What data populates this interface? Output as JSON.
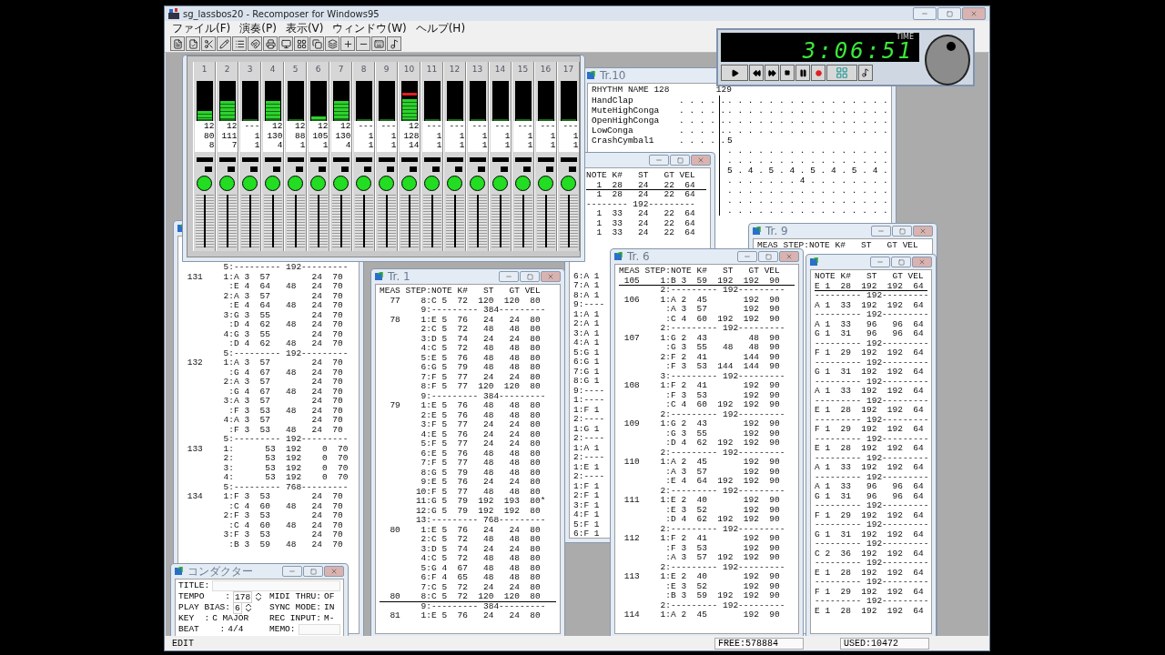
{
  "app": {
    "title": "sg_lassbos20 - Recomposer for Windows95",
    "menu": [
      "ファイル(F)",
      "演奏(P)",
      "表示(V)",
      "ウィンドウ(W)",
      "ヘルプ(H)"
    ]
  },
  "transport": {
    "time": "3:06:51",
    "time_label": "TIME"
  },
  "mixer": {
    "channels": [
      {
        "number": "1",
        "level": 0.25,
        "peak": false,
        "readings": [
          "12",
          "80",
          "8"
        ]
      },
      {
        "number": "2",
        "level": 0.5,
        "peak": false,
        "readings": [
          "12",
          "111",
          "7"
        ]
      },
      {
        "number": "3",
        "level": 0,
        "peak": false,
        "readings": [
          "---",
          "1",
          "1"
        ]
      },
      {
        "number": "4",
        "level": 0.5,
        "peak": false,
        "readings": [
          "12",
          "130",
          "4"
        ]
      },
      {
        "number": "5",
        "level": 0,
        "peak": false,
        "readings": [
          "12",
          "88",
          "1"
        ]
      },
      {
        "number": "6",
        "level": 0.12,
        "peak": false,
        "readings": [
          "12",
          "105",
          "1"
        ]
      },
      {
        "number": "7",
        "level": 0.5,
        "peak": false,
        "readings": [
          "12",
          "130",
          "4"
        ]
      },
      {
        "number": "8",
        "level": 0,
        "peak": false,
        "readings": [
          "---",
          "1",
          "1"
        ]
      },
      {
        "number": "9",
        "level": 0,
        "peak": false,
        "readings": [
          "---",
          "1",
          "1"
        ]
      },
      {
        "number": "10",
        "level": 0.55,
        "peak": true,
        "readings": [
          "12",
          "128",
          "14"
        ]
      },
      {
        "number": "11",
        "level": 0,
        "peak": false,
        "readings": [
          "---",
          "1",
          "1"
        ]
      },
      {
        "number": "12",
        "level": 0,
        "peak": false,
        "readings": [
          "---",
          "1",
          "1"
        ]
      },
      {
        "number": "13",
        "level": 0,
        "peak": false,
        "readings": [
          "---",
          "1",
          "1"
        ]
      },
      {
        "number": "14",
        "level": 0,
        "peak": false,
        "readings": [
          "---",
          "1",
          "1"
        ]
      },
      {
        "number": "15",
        "level": 0,
        "peak": false,
        "readings": [
          "---",
          "1",
          "1"
        ]
      },
      {
        "number": "16",
        "level": 0,
        "peak": false,
        "readings": [
          "---",
          "1",
          "1"
        ]
      },
      {
        "number": "17",
        "level": 0,
        "peak": false,
        "readings": [
          "---",
          "1",
          "1"
        ]
      }
    ]
  },
  "rhythm_window": {
    "title": "Tr.10",
    "header": "RHYTHM NAME 128         129",
    "rows": [
      {
        "name": "HandClap",
        "bar_128": ". . . . .",
        "bar_129": ". . . . . . . . . . . . . . . ."
      },
      {
        "name": "MuteHighConga",
        "bar_128": ". . . . .",
        "bar_129": ". . . . . . . . . . . . . . . ."
      },
      {
        "name": "OpenHighConga",
        "bar_128": ". . . . .",
        "bar_129": ". . . . . . . . . . . . . . . ."
      },
      {
        "name": "LowConga",
        "bar_128": ". . . . .",
        "bar_129": ". . . . . . . . . . . . . . . ."
      },
      {
        "name": "CrashCymbal1",
        "bar_128": ". . . . .",
        "bar_129": "5"
      },
      {
        "bar_129": ". . . . . . . . . . . . . . . ."
      },
      {
        "bar_129": ". . . . . . . . . . . . . . . ."
      },
      {
        "bar_129": "5 . 4 . 5 . 4 . 5 . 4 . 5 . 4 ."
      },
      {
        "bar_129": ". . . . . . . 4 . . . . . . . ."
      },
      {
        "bar_129": ". . . . . . . . . . . . . . . ."
      },
      {
        "bar_129": ". . . . . . . . . . . . . . . ."
      },
      {
        "bar_129": ". . . . . . . . . . . . . . . ."
      }
    ]
  },
  "left_list": {
    "rows": [
      "        5:--------- 192---------",
      " 131    1:A 3  57        24  70",
      "         :E 4  64   48   24  70",
      "        2:A 3  57        24  70",
      "         :E 4  64   48   24  70",
      "        3:G 3  55        24  70",
      "         :D 4  62   48   24  70",
      "        4:G 3  55        24  70",
      "         :D 4  62   48   24  70",
      "        5:--------- 192---------",
      " 132    1:A 3  57        24  70",
      "         :G 4  67   48   24  70",
      "        2:A 3  57        24  70",
      "         :G 4  67   48   24  70",
      "        3:A 3  57        24  70",
      "         :F 3  53   48   24  70",
      "        4:A 3  57        24  70",
      "         :F 3  53   48   24  70",
      "        5:--------- 192---------",
      " 133    1:      53  192    0  70",
      "        2:      53  192    0  70",
      "        3:      53  192    0  70",
      "        4:      53  192    0  70",
      "        5:--------- 768---------",
      " 134    1:F 3  53        24  70",
      "         :C 4  60   48   24  70",
      "        2:F 3  53        24  70",
      "         :C 4  60   48   24  70",
      "        3:F 3  53        24  70",
      "         :B 3  59   48   24  70"
    ]
  },
  "note_window": {
    "header": "NOTE K#   ST   GT VEL",
    "rows": [
      {
        "text": "  1  28   24   22  64",
        "current": true
      },
      "  1  28   24   22  64",
      "-------- 192---------",
      "  1  33   24   22  64",
      "  1  33   24   22  64",
      "  1  33   24   22  64"
    ],
    "strip_rows": [
      "6:A 1",
      "7:A 1",
      "8:A 1",
      "9:----",
      "1:A 1",
      "2:A 1",
      "3:A 1",
      "4:A 1",
      "5:G 1",
      "6:G 1",
      "7:G 1",
      "8:G 1",
      "9:----",
      "1:----",
      "1:F 1",
      "2:----",
      "1:G 1",
      "2:----",
      "1:A 1",
      "2:----",
      "1:E 1",
      "2:----",
      "1:F 1",
      "2:F 1",
      "3:F 1",
      "4:F 1",
      "5:F 1",
      "6:F 1"
    ]
  },
  "track_1": {
    "title": "Tr. 1",
    "header": "MEAS STEP:NOTE K#   ST   GT VEL",
    "rows": [
      "  77    8:C 5  72  120  120  80",
      "        9:--------- 384---------",
      "  78    1:E 5  76   24   24  80",
      "        2:C 5  72   48   48  80",
      "        3:D 5  74   24   24  80",
      "        4:C 5  72   48   48  80",
      "        5:E 5  76   48   48  80",
      "        6:G 5  79   48   48  80",
      "        7:F 5  77   24   24  80",
      "        8:F 5  77  120  120  80",
      "        9:--------- 384---------",
      "  79    1:E 5  76   48   48  80",
      "        2:E 5  76   48   48  80",
      "        3:F 5  77   24   24  80",
      "        4:E 5  76   24   24  80",
      "        5:F 5  77   24   24  80",
      "        6:E 5  76   48   48  80",
      "        7:F 5  77   48   48  80",
      "        8:G 5  79   48   48  80",
      "        9:E 5  76   24   24  80",
      "       10:F 5  77   48   48  80",
      "       11:G 5  79  192  193  80*",
      "       12:G 5  79  192  192  80",
      "       13:--------- 768---------",
      "  80    1:E 5  76   24   24  80",
      "        2:C 5  72   48   48  80",
      "        3:D 5  74   24   24  80",
      "        4:C 5  72   48   48  80",
      "        5:G 4  67   48   48  80",
      "        6:F 4  65   48   48  80",
      "        7:C 5  72   24   24  80",
      {
        "text": "  80    8:C 5  72  120  120  80",
        "current": true
      },
      "        9:--------- 384---------",
      "  81    1:E 5  76   24   24  80"
    ]
  },
  "track_9": {
    "title": "Tr. 9",
    "header": "MEAS STEP:NOTE K#   ST   GT VEL"
  },
  "right_list": {
    "header": "NOTE K#   ST   GT VEL",
    "rows": [
      {
        "text": "E 1  28  192  192  64",
        "current": true
      },
      "--------- 192---------",
      "A 1  33  192  192  64",
      "--------- 192---------",
      "A 1  33   96   96  64",
      "G 1  31   96   96  64",
      "--------- 192---------",
      "F 1  29  192  192  64",
      "--------- 192---------",
      "G 1  31  192  192  64",
      "--------- 192---------",
      "A 1  33  192  192  64",
      "--------- 192---------",
      "E 1  28  192  192  64",
      "--------- 192---------",
      "F 1  29  192  192  64",
      "--------- 192---------",
      "E 1  28  192  192  64",
      "--------- 192---------",
      "A 1  33  192  192  64",
      "--------- 192---------",
      "A 1  33   96   96  64",
      "G 1  31   96   96  64",
      "--------- 192---------",
      "F 1  29  192  192  64",
      "--------- 192---------",
      "G 1  31  192  192  64",
      "--------- 192---------",
      "C 2  36  192  192  64",
      "--------- 192---------",
      "E 1  28  192  192  64",
      "--------- 192---------",
      "F 1  29  192  192  64",
      "--------- 192---------",
      "E 1  28  192  192  64"
    ]
  },
  "track_6": {
    "title": "Tr. 6",
    "header": "MEAS STEP:NOTE K#   ST   GT VEL",
    "rows": [
      {
        "text": " 105    1:B 3  59  192  192  90",
        "current": true
      },
      "        2:--------- 192---------",
      " 106    1:A 2  45       192  90",
      "         :A 3  57       192  90",
      "         :C 4  60  192  192  90",
      "        2:--------- 192---------",
      " 107    1:G 2  43        48  90",
      "         :G 3  55   48   48  90",
      "        2:F 2  41       144  90",
      "         :F 3  53  144  144  90",
      "        3:--------- 192---------",
      " 108    1:F 2  41       192  90",
      "         :F 3  53       192  90",
      "         :C 4  60  192  192  90",
      "        2:--------- 192---------",
      " 109    1:G 2  43       192  90",
      "         :G 3  55       192  90",
      "         :D 4  62  192  192  90",
      "        2:--------- 192---------",
      " 110    1:A 2  45       192  90",
      "         :A 3  57       192  90",
      "         :E 4  64  192  192  90",
      "        2:--------- 192---------",
      " 111    1:E 2  40       192  90",
      "         :E 3  52       192  90",
      "         :D 4  62  192  192  90",
      "        2:--------- 192---------",
      " 112    1:F 2  41       192  90",
      "         :F 3  53       192  90",
      "         :A 3  57  192  192  90",
      "        2:--------- 192---------",
      " 113    1:E 2  40       192  90",
      "         :E 3  52       192  90",
      "         :B 3  59  192  192  90",
      "        2:--------- 192---------",
      " 114    1:A 2  45       192  90"
    ]
  },
  "conductor": {
    "title": "コンダクター",
    "title_label": "TITLE:",
    "left": [
      {
        "kind": "spinner",
        "label": "TEMPO    :",
        "value": "178"
      },
      {
        "kind": "spinner",
        "label": "PLAY BIAS:",
        "value": "6"
      },
      {
        "kind": "value",
        "label": "KEY  :",
        "value": "C MAJOR"
      },
      {
        "kind": "value",
        "label": "BEAT    :",
        "value": "4/4"
      }
    ],
    "right": [
      {
        "kind": "value",
        "label": "MIDI THRU:",
        "value": "OF"
      },
      {
        "kind": "value",
        "label": "SYNC MODE:",
        "value": "IN"
      },
      {
        "kind": "value",
        "label": "REC INPUT:",
        "value": "M-"
      },
      {
        "kind": "field",
        "label": "MEMO:"
      }
    ]
  },
  "status_bar": {
    "mode": "EDIT",
    "free": "FREE:578884",
    "used": "USED:10472"
  }
}
